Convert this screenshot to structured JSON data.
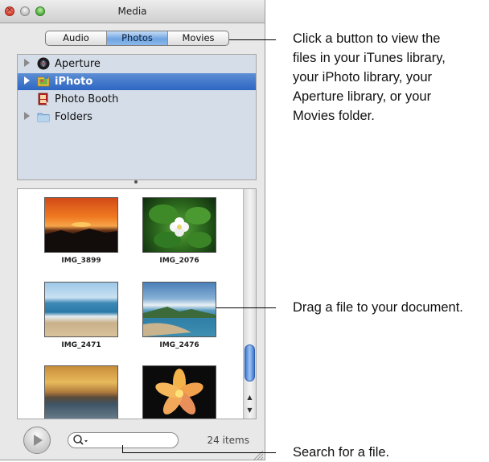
{
  "window": {
    "title": "Media"
  },
  "tabs": [
    {
      "label": "Audio",
      "selected": false
    },
    {
      "label": "Photos",
      "selected": true
    },
    {
      "label": "Movies",
      "selected": false
    }
  ],
  "sources": [
    {
      "label": "Aperture",
      "icon": "aperture-icon",
      "expandable": true,
      "selected": false
    },
    {
      "label": "iPhoto",
      "icon": "iphoto-icon",
      "expandable": true,
      "selected": true
    },
    {
      "label": "Photo Booth",
      "icon": "photo-booth-icon",
      "expandable": false,
      "selected": false
    },
    {
      "label": "Folders",
      "icon": "folder-icon",
      "expandable": true,
      "selected": false
    }
  ],
  "photos": [
    {
      "name": "IMG_3899",
      "subject": "sunset"
    },
    {
      "name": "IMG_2076",
      "subject": "white flower"
    },
    {
      "name": "IMG_2471",
      "subject": "beach waves"
    },
    {
      "name": "IMG_2476",
      "subject": "coastline"
    },
    {
      "name": "",
      "subject": "golden sky"
    },
    {
      "name": "",
      "subject": "plumeria flower"
    }
  ],
  "search": {
    "value": "",
    "placeholder": ""
  },
  "status": {
    "item_count": "24 items"
  },
  "callouts": {
    "buttons": [
      "Click a button to view the",
      "files in your iTunes library,",
      "your iPhoto library, your",
      "Aperture library, or your",
      "Movies folder."
    ],
    "drag": "Drag a file to your document.",
    "search": "Search for a file."
  },
  "colors": {
    "selection": "#2d66c3",
    "segment_selected": "#6fa5e2",
    "source_list_bg": "#d5dde8"
  }
}
